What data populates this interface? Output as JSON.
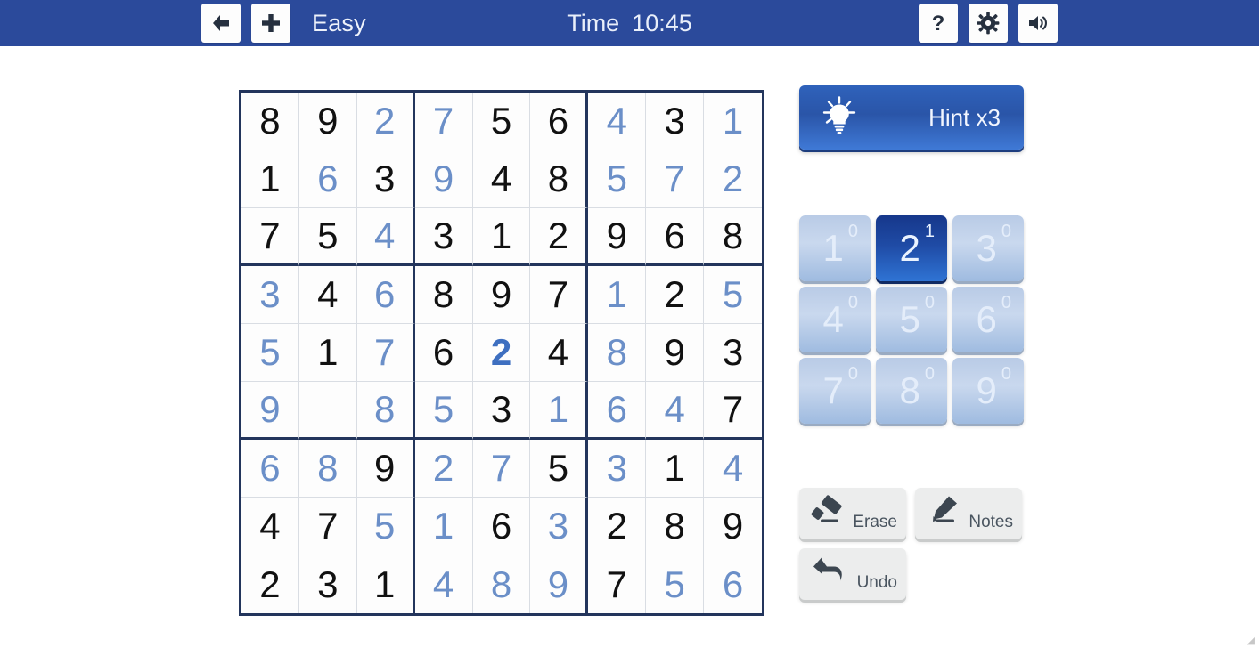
{
  "titlebar": {
    "back_icon": "arrow-left-icon",
    "new_icon": "plus-icon",
    "difficulty": "Easy",
    "time_label": "Time",
    "time_value": "10:45",
    "help_icon": "question-mark-icon",
    "settings_icon": "gear-icon",
    "sound_icon": "speaker-icon",
    "bg_color": "#2b4a9b"
  },
  "board": {
    "given_color": "#111111",
    "user_color": "#6b8fc8",
    "recent_color": "#3e6fc0",
    "grid_line_color": "#23355c",
    "rows": [
      [
        {
          "v": "8",
          "t": "given"
        },
        {
          "v": "9",
          "t": "given"
        },
        {
          "v": "2",
          "t": "user"
        },
        {
          "v": "7",
          "t": "user"
        },
        {
          "v": "5",
          "t": "given"
        },
        {
          "v": "6",
          "t": "given"
        },
        {
          "v": "4",
          "t": "user"
        },
        {
          "v": "3",
          "t": "given"
        },
        {
          "v": "1",
          "t": "user"
        }
      ],
      [
        {
          "v": "1",
          "t": "given"
        },
        {
          "v": "6",
          "t": "user"
        },
        {
          "v": "3",
          "t": "given"
        },
        {
          "v": "9",
          "t": "user"
        },
        {
          "v": "4",
          "t": "given"
        },
        {
          "v": "8",
          "t": "given"
        },
        {
          "v": "5",
          "t": "user"
        },
        {
          "v": "7",
          "t": "user"
        },
        {
          "v": "2",
          "t": "user"
        }
      ],
      [
        {
          "v": "7",
          "t": "given"
        },
        {
          "v": "5",
          "t": "given"
        },
        {
          "v": "4",
          "t": "user"
        },
        {
          "v": "3",
          "t": "given"
        },
        {
          "v": "1",
          "t": "given"
        },
        {
          "v": "2",
          "t": "given"
        },
        {
          "v": "9",
          "t": "given"
        },
        {
          "v": "6",
          "t": "given"
        },
        {
          "v": "8",
          "t": "given"
        }
      ],
      [
        {
          "v": "3",
          "t": "user"
        },
        {
          "v": "4",
          "t": "given"
        },
        {
          "v": "6",
          "t": "user"
        },
        {
          "v": "8",
          "t": "given"
        },
        {
          "v": "9",
          "t": "given"
        },
        {
          "v": "7",
          "t": "given"
        },
        {
          "v": "1",
          "t": "user"
        },
        {
          "v": "2",
          "t": "given"
        },
        {
          "v": "5",
          "t": "user"
        }
      ],
      [
        {
          "v": "5",
          "t": "user"
        },
        {
          "v": "1",
          "t": "given"
        },
        {
          "v": "7",
          "t": "user"
        },
        {
          "v": "6",
          "t": "given"
        },
        {
          "v": "2",
          "t": "recent"
        },
        {
          "v": "4",
          "t": "given"
        },
        {
          "v": "8",
          "t": "user"
        },
        {
          "v": "9",
          "t": "given"
        },
        {
          "v": "3",
          "t": "given"
        }
      ],
      [
        {
          "v": "9",
          "t": "user"
        },
        {
          "v": "",
          "t": "empty"
        },
        {
          "v": "8",
          "t": "user"
        },
        {
          "v": "5",
          "t": "user"
        },
        {
          "v": "3",
          "t": "given"
        },
        {
          "v": "1",
          "t": "user"
        },
        {
          "v": "6",
          "t": "user"
        },
        {
          "v": "4",
          "t": "user"
        },
        {
          "v": "7",
          "t": "given"
        }
      ],
      [
        {
          "v": "6",
          "t": "user"
        },
        {
          "v": "8",
          "t": "user"
        },
        {
          "v": "9",
          "t": "given"
        },
        {
          "v": "2",
          "t": "user"
        },
        {
          "v": "7",
          "t": "user"
        },
        {
          "v": "5",
          "t": "given"
        },
        {
          "v": "3",
          "t": "user"
        },
        {
          "v": "1",
          "t": "given"
        },
        {
          "v": "4",
          "t": "user"
        }
      ],
      [
        {
          "v": "4",
          "t": "given"
        },
        {
          "v": "7",
          "t": "given"
        },
        {
          "v": "5",
          "t": "user"
        },
        {
          "v": "1",
          "t": "user"
        },
        {
          "v": "6",
          "t": "given"
        },
        {
          "v": "3",
          "t": "user"
        },
        {
          "v": "2",
          "t": "given"
        },
        {
          "v": "8",
          "t": "given"
        },
        {
          "v": "9",
          "t": "given"
        }
      ],
      [
        {
          "v": "2",
          "t": "given"
        },
        {
          "v": "3",
          "t": "given"
        },
        {
          "v": "1",
          "t": "given"
        },
        {
          "v": "4",
          "t": "user"
        },
        {
          "v": "8",
          "t": "user"
        },
        {
          "v": "9",
          "t": "user"
        },
        {
          "v": "7",
          "t": "given"
        },
        {
          "v": "5",
          "t": "user"
        },
        {
          "v": "6",
          "t": "user"
        }
      ]
    ]
  },
  "panel": {
    "hint": {
      "label": "Hint x3",
      "icon": "lightbulb-icon",
      "color": "#2a55a8"
    },
    "numpad": {
      "selected": "2",
      "keys": [
        {
          "digit": "1",
          "count": "0",
          "selected": false
        },
        {
          "digit": "2",
          "count": "1",
          "selected": true
        },
        {
          "digit": "3",
          "count": "0",
          "selected": false
        },
        {
          "digit": "4",
          "count": "0",
          "selected": false
        },
        {
          "digit": "5",
          "count": "0",
          "selected": false
        },
        {
          "digit": "6",
          "count": "0",
          "selected": false
        },
        {
          "digit": "7",
          "count": "0",
          "selected": false
        },
        {
          "digit": "8",
          "count": "0",
          "selected": false
        },
        {
          "digit": "9",
          "count": "0",
          "selected": false
        }
      ]
    },
    "actions": [
      {
        "label": "Erase",
        "icon": "eraser-icon"
      },
      {
        "label": "Notes",
        "icon": "pencil-icon"
      },
      {
        "label": "Undo",
        "icon": "undo-arrow-icon"
      }
    ]
  }
}
